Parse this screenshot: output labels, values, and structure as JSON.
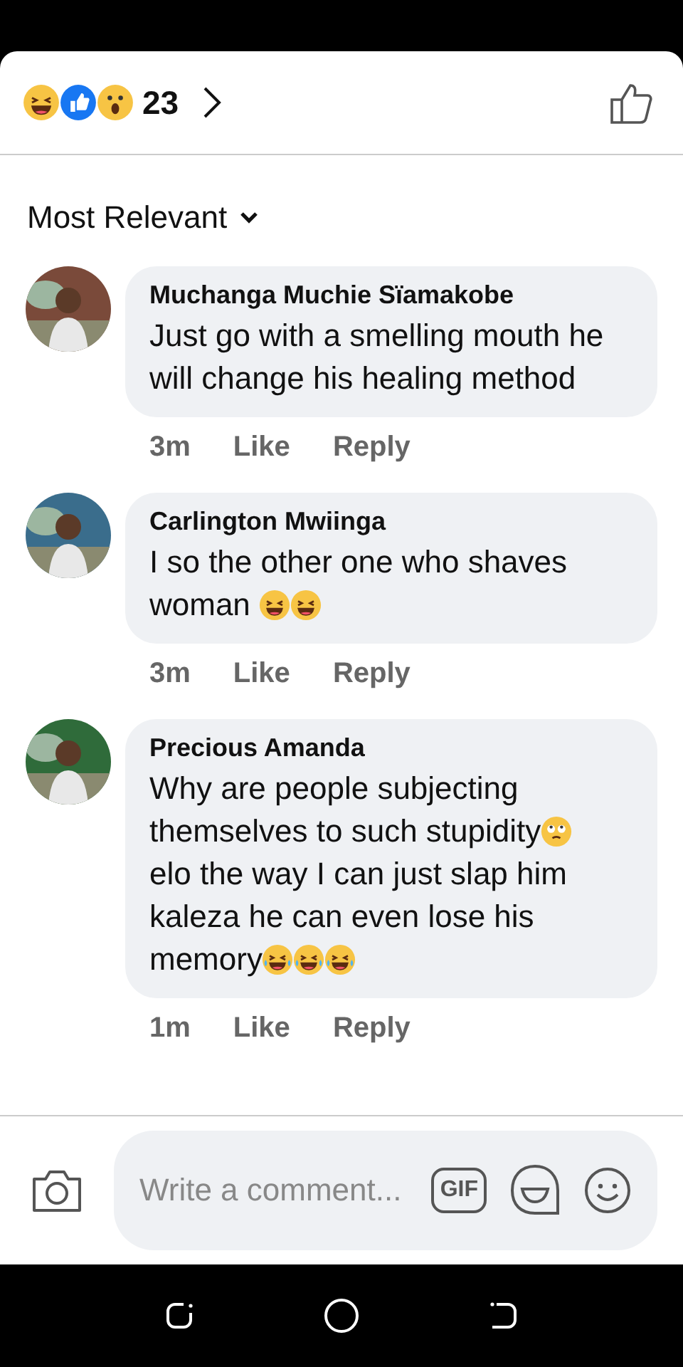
{
  "reactions": {
    "emojis": [
      {
        "kind": "haha"
      },
      {
        "kind": "like"
      },
      {
        "kind": "wow"
      }
    ],
    "count": "23"
  },
  "sort": {
    "label": "Most Relevant"
  },
  "comments": [
    {
      "name": "Muchanga Muchie Sïamakobe",
      "text": "Just go with a smelling mouth he will change his healing method",
      "time": "3m",
      "like": "Like",
      "reply": "Reply"
    },
    {
      "name": "Carlington Mwiinga",
      "text": "I so the other one who shaves woman ",
      "emojis": [
        {
          "kind": "rofl"
        },
        {
          "kind": "rofl"
        }
      ],
      "time": "3m",
      "like": "Like",
      "reply": "Reply"
    },
    {
      "name": "Precious Amanda",
      "text": "Why are people subjecting themselves to such stupidity",
      "emojis": [
        {
          "kind": "eyeroll"
        }
      ],
      "text2": " elo the way I can just slap him kaleza he can even lose his memory",
      "emojis2": [
        {
          "kind": "joy"
        },
        {
          "kind": "joy"
        },
        {
          "kind": "joy"
        }
      ],
      "time": "1m",
      "like": "Like",
      "reply": "Reply"
    }
  ],
  "composer": {
    "placeholder": "Write a comment...",
    "gif": "GIF"
  }
}
